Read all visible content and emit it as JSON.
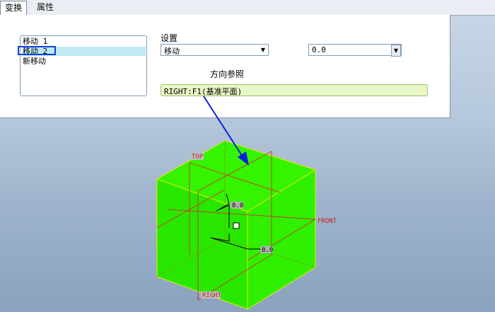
{
  "tabs": [
    "变换",
    "属性"
  ],
  "list": {
    "items": [
      "移动 1",
      "移动 2",
      "新移动"
    ],
    "selected_index": 1
  },
  "settings": {
    "label": "设置",
    "mode_value": "移动",
    "amount_value": "0.0"
  },
  "direction_ref": {
    "label": "方向参照",
    "value": "RIGHT:F1(基准平面)"
  },
  "viewport": {
    "plane_labels": {
      "top": "TOP",
      "front": "FRONT",
      "right": "RIGHT"
    },
    "dim_top": "0.0",
    "dim_bottom": "0.0"
  },
  "colors": {
    "cube_fill": "#2ef000",
    "cube_edge": "#e8e800",
    "plane": "#d03030",
    "annotation_arrow": "#0a1ee0"
  }
}
